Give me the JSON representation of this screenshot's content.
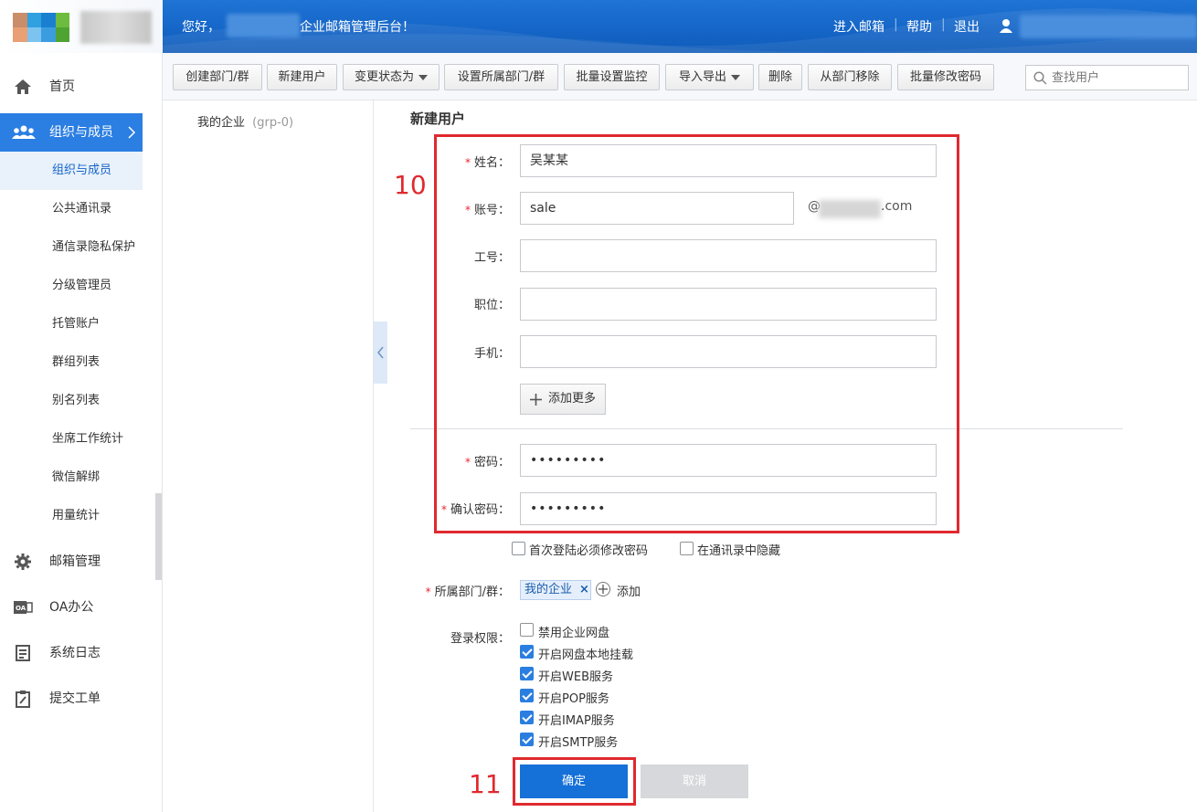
{
  "header": {
    "greeting_prefix": "您好，",
    "greeting_suffix": "企业邮箱管理后台！",
    "links": [
      "进入邮箱",
      "帮助",
      "退出"
    ]
  },
  "toolbar": {
    "buttons": [
      "创建部门/群",
      "新建用户",
      "变更状态为",
      "设置所属部门/群",
      "批量设置监控",
      "导入导出",
      "删除",
      "从部门移除",
      "批量修改密码"
    ],
    "search_placeholder": "查找用户"
  },
  "sidebar": {
    "items": [
      {
        "label": "首页",
        "icon": "home-icon"
      },
      {
        "label": "组织与成员",
        "icon": "users-icon"
      },
      {
        "label": "邮箱管理",
        "icon": "gear-icon"
      },
      {
        "label": "OA办公",
        "icon": "oa-icon"
      },
      {
        "label": "系统日志",
        "icon": "log-icon"
      },
      {
        "label": "提交工单",
        "icon": "ticket-icon"
      }
    ],
    "subitems": [
      "组织与成员",
      "公共通讯录",
      "通信录隐私保护",
      "分级管理员",
      "托管账户",
      "群组列表",
      "别名列表",
      "坐席工作统计",
      "微信解绑",
      "用量统计"
    ]
  },
  "tree": {
    "root_label": "我的企业",
    "root_id": "(grp-0)"
  },
  "form": {
    "title": "新建用户",
    "fields": [
      {
        "label": "姓名：",
        "value": "吴某某"
      },
      {
        "label": "账号：",
        "value": "sale"
      },
      {
        "label": "工号：",
        "value": ""
      },
      {
        "label": "职位：",
        "value": ""
      },
      {
        "label": "手机：",
        "value": ""
      },
      {
        "label": "密码：",
        "value": "•••••••••"
      },
      {
        "label": "确认密码：",
        "value": "•••••••••"
      }
    ],
    "domain_at": "@",
    "domain_suffix": ".com",
    "add_more": "添加更多",
    "options": [
      {
        "label": "首次登陆必须修改密码",
        "checked": false
      },
      {
        "label": "在通讯录中隐藏",
        "checked": false
      }
    ],
    "dept_label": "所属部门/群：",
    "dept_tag": "我的企业",
    "dept_add": "添加",
    "perm_label": "登录权限：",
    "perms": [
      {
        "label": "禁用企业网盘",
        "checked": false
      },
      {
        "label": "开启网盘本地挂载",
        "checked": true
      },
      {
        "label": "开启WEB服务",
        "checked": true
      },
      {
        "label": "开启POP服务",
        "checked": true
      },
      {
        "label": "开启IMAP服务",
        "checked": true
      },
      {
        "label": "开启SMTP服务",
        "checked": true
      }
    ],
    "confirm": "确定",
    "cancel": "取消"
  },
  "annotations": [
    "10",
    "11"
  ],
  "colors": {
    "primary": "#1570d8",
    "annotation": "#e0292e"
  }
}
